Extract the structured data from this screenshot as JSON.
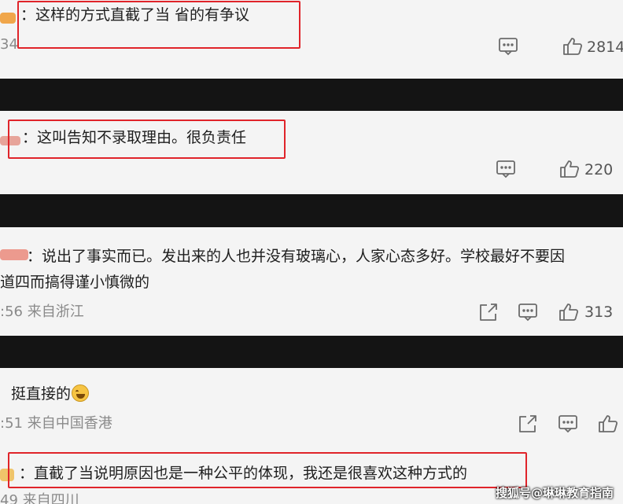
{
  "comments": [
    {
      "text": "：这样的方式直截了当 省的有争议",
      "meta": "34",
      "likes": "2814"
    },
    {
      "text": "：这叫告知不录取理由。很负责任",
      "likes": "220"
    },
    {
      "text_line1": "：说出了事实而已。发出来的人也并没有玻璃心，人家心态多好。学校最好不要因",
      "text_line2": "道四而搞得谨小慎微的",
      "meta": ":56 来自浙江",
      "likes": "313"
    },
    {
      "text": "挺直接的",
      "meta": ":51 来自中国香港"
    },
    {
      "text": "：直截了当说明原因也是一种公平的体现，我还是很喜欢这种方式的",
      "meta": "49 来自四川"
    }
  ],
  "watermark": "搜狐号@琳琳教育指南",
  "colors": {
    "highlight_box": "#e0242a",
    "panel_bg": "#f4f4f4",
    "divider": "#141414",
    "meta_text": "#8a8a8a"
  },
  "icons": [
    "comment-icon",
    "like-icon",
    "share-icon",
    "laughing-emoji"
  ]
}
